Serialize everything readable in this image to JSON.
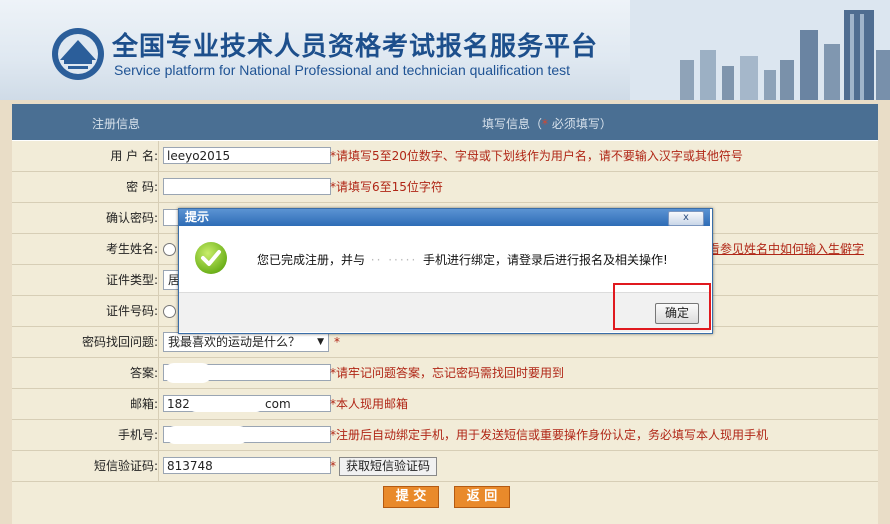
{
  "banner": {
    "title_cn": "全国专业技术人员资格考试报名服务平台",
    "title_en": "Service platform for National Professional and technician  qualification test"
  },
  "form": {
    "header_left": "注册信息",
    "header_right_pre": "填写信息（",
    "header_right_star": "*",
    "header_right_post": " 必须填写）",
    "rows": [
      {
        "label": "用 户 名:",
        "value": "leeyo2015",
        "hint": "*请填写5至20位数字、字母或下划线作为用户名，请不要输入汉字或其他符号"
      },
      {
        "label": "密    码:",
        "value": "",
        "hint": "*请填写6至15位字符"
      },
      {
        "label": "确认密码:",
        "value": "",
        "hint": ""
      },
      {
        "label": "考生姓名:",
        "value": "",
        "hint": "",
        "link": "看参见姓名中如何输入生僻字"
      },
      {
        "label": "证件类型:",
        "value": "居",
        "hint": ""
      },
      {
        "label": "证件号码:",
        "value": "",
        "hint": ""
      },
      {
        "label": "密码找回问题:",
        "value": "我最喜欢的运动是什么？",
        "hint": "*"
      },
      {
        "label": "答案:",
        "value": "",
        "hint": "*请牢记问题答案，忘记密码需找回时要用到"
      },
      {
        "label": "邮箱:",
        "value": "182",
        "value_suffix": "com",
        "hint": "*本人现用邮箱"
      },
      {
        "label": "手机号:",
        "value": "",
        "hint": "*注册后自动绑定手机，用于发送短信或重要操作身份认定，务必填写本人现用手机"
      },
      {
        "label": "短信验证码:",
        "value": "813748",
        "hint": "*",
        "button": "获取短信验证码"
      }
    ],
    "submit_label": "提 交",
    "back_label": "返 回"
  },
  "dialog": {
    "title": "提示",
    "close_label": "x",
    "message_pre": "您已完成注册，并与",
    "message_masked": "·· ·····",
    "message_post": "手机进行绑定，请登录后进行报名及相关操作!",
    "ok_label": "确定"
  },
  "colors": {
    "header_bg": "#4a6f93",
    "hint_red": "#b02616",
    "button_orange": "#e98a2b",
    "highlight_red": "#e0191f"
  }
}
